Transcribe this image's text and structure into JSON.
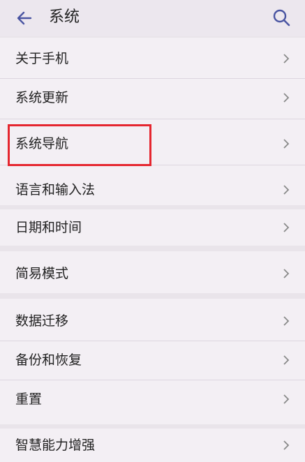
{
  "header": {
    "title": "系统",
    "back_icon": "arrow-left-icon",
    "search_icon": "search-icon"
  },
  "colors": {
    "highlight": "#e5262f",
    "accent": "#4a55a2"
  },
  "items": [
    {
      "label": "关于手机"
    },
    {
      "label": "系统更新"
    },
    {
      "label": "系统导航"
    },
    {
      "label": "语言和输入法"
    },
    {
      "label": "日期和时间"
    },
    {
      "label": "简易模式"
    },
    {
      "label": "数据迁移"
    },
    {
      "label": "备份和恢复"
    },
    {
      "label": "重置"
    },
    {
      "label": "智慧能力增强"
    }
  ]
}
